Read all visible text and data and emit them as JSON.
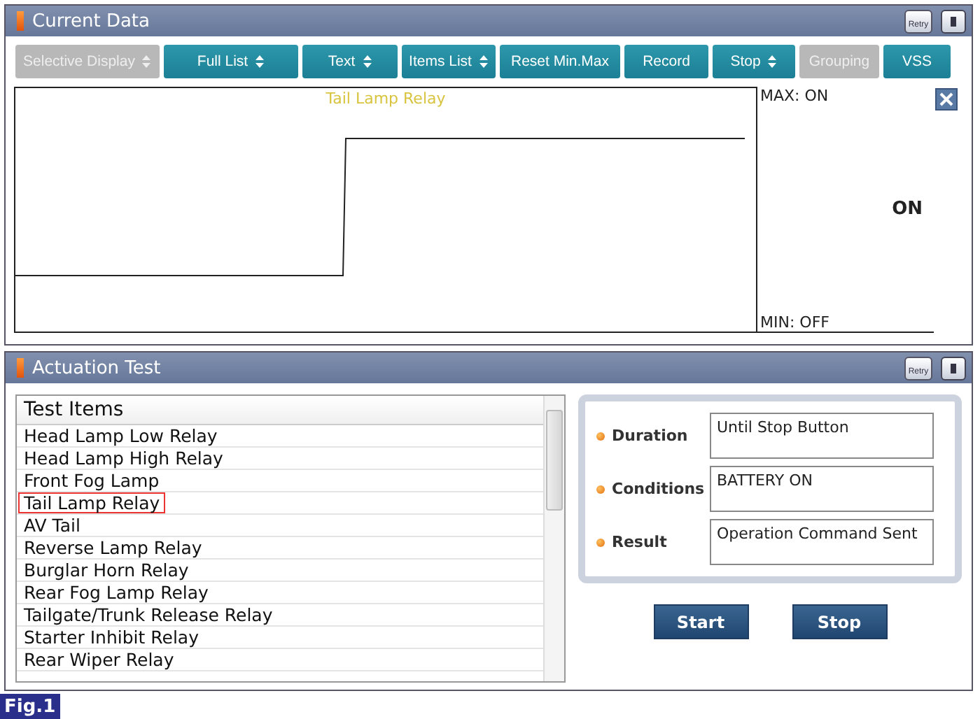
{
  "current_data": {
    "title": "Current Data",
    "retry_label": "Retry",
    "toolbar": [
      {
        "label": "Selective Display",
        "dropdown": true,
        "disabled": true
      },
      {
        "label": "Full List",
        "dropdown": true,
        "disabled": false
      },
      {
        "label": "Text",
        "dropdown": true,
        "disabled": false
      },
      {
        "label": "Items List",
        "dropdown": true,
        "disabled": false
      },
      {
        "label": "Reset Min.Max",
        "dropdown": false,
        "disabled": false
      },
      {
        "label": "Record",
        "dropdown": false,
        "disabled": false
      },
      {
        "label": "Stop",
        "dropdown": true,
        "disabled": false
      },
      {
        "label": "Grouping",
        "dropdown": false,
        "disabled": true
      },
      {
        "label": "VSS",
        "dropdown": false,
        "disabled": false
      }
    ],
    "graph": {
      "title": "Tail Lamp Relay",
      "max_label": "MAX: ON",
      "min_label": "MIN: OFF",
      "value": "ON"
    }
  },
  "actuation_test": {
    "title": "Actuation Test",
    "retry_label": "Retry",
    "list_header": "Test Items",
    "items": [
      {
        "label": "Head Lamp Low Relay",
        "selected": false
      },
      {
        "label": "Head Lamp High Relay",
        "selected": false
      },
      {
        "label": "Front Fog Lamp",
        "selected": false
      },
      {
        "label": "Tail Lamp Relay",
        "selected": true
      },
      {
        "label": "AV Tail",
        "selected": false
      },
      {
        "label": "Reverse Lamp Relay",
        "selected": false
      },
      {
        "label": "Burglar Horn Relay",
        "selected": false
      },
      {
        "label": "Rear Fog Lamp Relay",
        "selected": false
      },
      {
        "label": "Tailgate/Trunk Release Relay",
        "selected": false
      },
      {
        "label": "Starter Inhibit Relay",
        "selected": false
      },
      {
        "label": "Rear Wiper Relay",
        "selected": false
      }
    ],
    "fields": [
      {
        "label": "Duration",
        "value": "Until Stop Button"
      },
      {
        "label": "Conditions",
        "value": "BATTERY ON"
      },
      {
        "label": "Result",
        "value": "Operation Command Sent"
      }
    ],
    "buttons": [
      "Start",
      "Stop"
    ]
  },
  "figure_label": "Fig.1"
}
